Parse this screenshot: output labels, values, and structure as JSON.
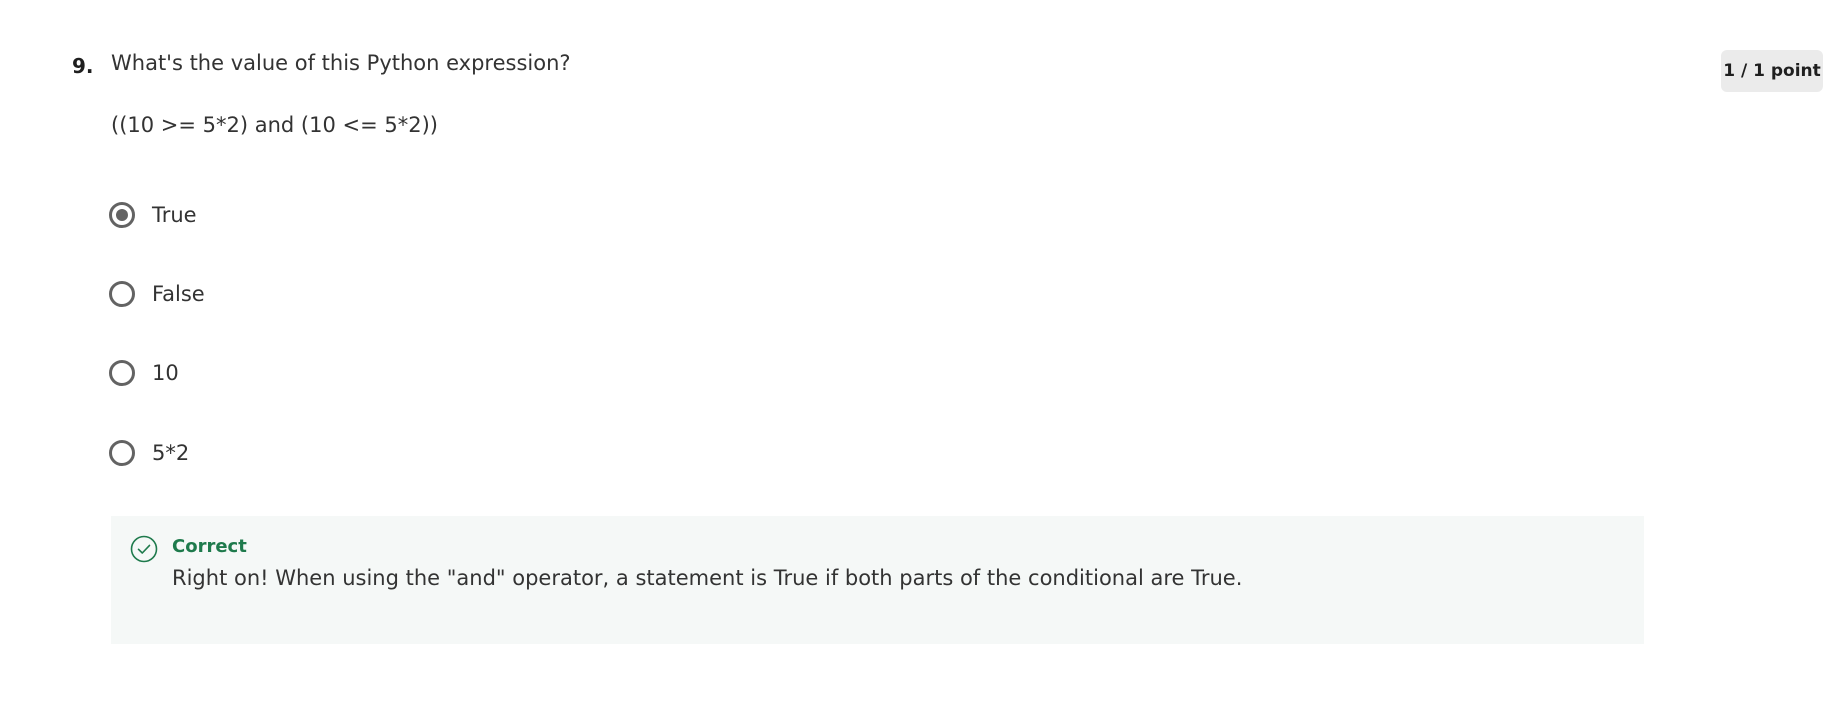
{
  "question": {
    "number": "9.",
    "prompt": "What's the value of this Python expression?",
    "expression": "((10 >= 5*2) and (10 <= 5*2))",
    "points": "1 / 1 point"
  },
  "options": [
    {
      "label": "True",
      "selected": true
    },
    {
      "label": "False",
      "selected": false
    },
    {
      "label": "10",
      "selected": false
    },
    {
      "label": "5*2",
      "selected": false
    }
  ],
  "feedback": {
    "icon": "check-circle-icon",
    "title": "Correct",
    "message": "Right on! When using the \"and\" operator, a statement is True if both parts of the conditional are True."
  },
  "colors": {
    "correct": "#1e7a4c",
    "feedback_bg": "#f5f8f7",
    "radio": "#636363",
    "badge_bg": "#ebebeb"
  }
}
